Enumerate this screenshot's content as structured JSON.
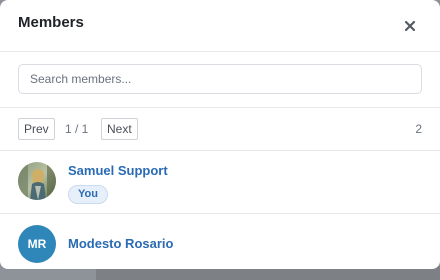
{
  "dialog": {
    "title": "Members",
    "close_icon": "close-icon"
  },
  "search": {
    "placeholder": "Search members...",
    "value": ""
  },
  "pagination": {
    "prev_label": "Prev",
    "page_indicator": "1 / 1",
    "next_label": "Next",
    "total": "2"
  },
  "members": [
    {
      "name": "Samuel Support",
      "badge": "You",
      "avatar_type": "photo"
    },
    {
      "name": "Modesto Rosario",
      "initials": "MR",
      "avatar_type": "initials"
    }
  ],
  "colors": {
    "link": "#2a6bb3",
    "initials_avatar_bg": "#2f86b8",
    "badge_bg": "#e6effa",
    "overlay": "#8e9399"
  }
}
